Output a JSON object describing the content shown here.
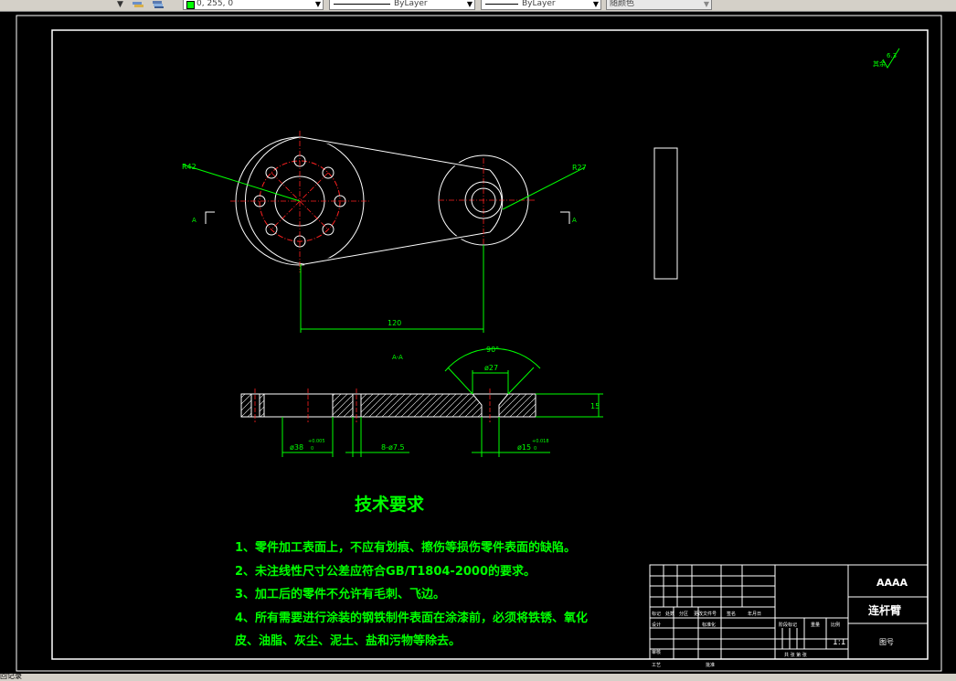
{
  "toolbar": {
    "color_value": "0, 255, 0",
    "linetype_label": "ByLayer",
    "lineweight_label": "ByLayer",
    "plotstyle_label": "随颜色"
  },
  "drawing": {
    "dims": {
      "r42": "R42",
      "r27": "R27",
      "len120": "120",
      "angle90": "90°",
      "dia27": "ø27",
      "thick": "15",
      "dia38": "ø38",
      "tol_upper": "+0.005",
      "tol_lower": "0",
      "holes": "8-ø7.5",
      "dia15": "ø15",
      "tol15_upper": "+0.018",
      "tol15_lower": "0",
      "section_a": "A",
      "section_a2": "A",
      "section_aa": "A-A",
      "roughness_label": "其余",
      "roughness_value": "6.3"
    },
    "tech": {
      "title": "技术要求",
      "req1": "1、零件加工表面上，不应有划痕、擦伤等损伤零件表面的缺陷。",
      "req2": "2、未注线性尺寸公差应符合GB/T1804-2000的要求。",
      "req3": "3、加工后的零件不允许有毛刺、飞边。",
      "req4a": "4、所有需要进行涂装的钢铁制件表面在涂漆前，必须将铁锈、氧化",
      "req4b": "皮、油脂、灰尘、泥土、盐和污物等除去。"
    },
    "titleblock": {
      "company": "AAAA",
      "part_name": "连杆臂",
      "scale": "1:1",
      "drawing_no": "图号",
      "h_mark": "标记",
      "h_count": "处数",
      "h_zone": "分区",
      "h_change": "更改文件号",
      "h_sign": "签名",
      "h_date": "年月日",
      "design": "设计",
      "standard": "标准化",
      "review": "审核",
      "process": "工艺",
      "approve": "批准",
      "stage": "阶段标记",
      "weight": "重量",
      "ratio": "比例",
      "sheets": "共  张  第  张"
    }
  },
  "status": {
    "prompt": "回记录"
  }
}
